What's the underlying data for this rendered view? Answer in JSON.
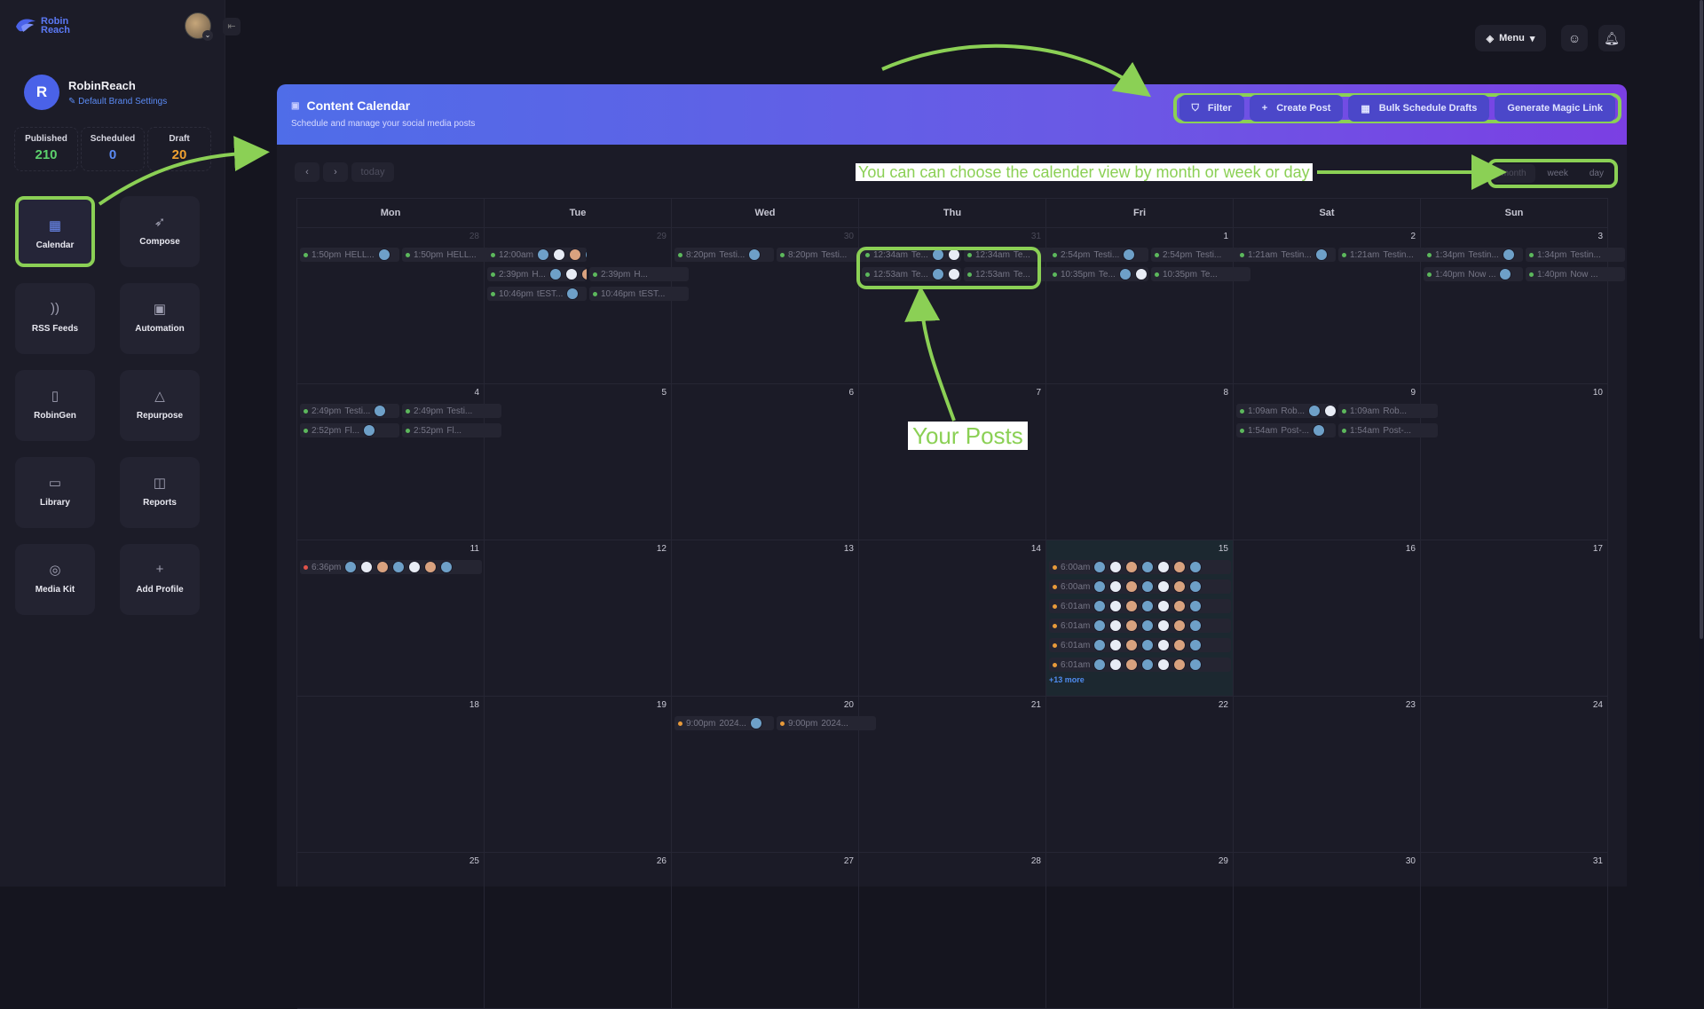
{
  "logo": {
    "text": "Robin Reach"
  },
  "profile": {
    "initial": "R",
    "name": "RobinReach",
    "brand_settings": "Default Brand Settings"
  },
  "stats": [
    {
      "label": "Published",
      "value": "210",
      "color": "#5cd06c"
    },
    {
      "label": "Scheduled",
      "value": "0",
      "color": "#5b8bf5"
    },
    {
      "label": "Draft",
      "value": "20",
      "color": "#f0a030"
    }
  ],
  "tiles": [
    {
      "label": "Calendar",
      "icon": "calendar-icon",
      "glyph": "▦"
    },
    {
      "label": "Compose",
      "icon": "rocket-icon",
      "glyph": "➶"
    },
    {
      "label": "RSS Feeds",
      "icon": "rss-icon",
      "glyph": "))"
    },
    {
      "label": "Automation",
      "icon": "robot-icon",
      "glyph": "▣"
    },
    {
      "label": "RobinGen",
      "icon": "document-icon",
      "glyph": "▯"
    },
    {
      "label": "Repurpose",
      "icon": "recycle-icon",
      "glyph": "△"
    },
    {
      "label": "Library",
      "icon": "folder-icon",
      "glyph": "▭"
    },
    {
      "label": "Reports",
      "icon": "chart-icon",
      "glyph": "◫"
    },
    {
      "label": "Media Kit",
      "icon": "grid-icon",
      "glyph": "◎"
    },
    {
      "label": "Add Profile",
      "icon": "plus-icon",
      "glyph": "+"
    }
  ],
  "topbar": {
    "menu_label": "Menu"
  },
  "header": {
    "title": "Content Calendar",
    "subtitle": "Schedule and manage your social media posts",
    "buttons": [
      {
        "label": "Filter",
        "icon": "filter-icon",
        "glyph": "⛉"
      },
      {
        "label": "Create Post",
        "icon": "plus-icon",
        "glyph": "+"
      },
      {
        "label": "Bulk Schedule Drafts",
        "icon": "calendar-icon",
        "glyph": "▦"
      },
      {
        "label": "Generate Magic Link",
        "icon": "",
        "glyph": ""
      }
    ]
  },
  "nav": {
    "prev": "‹",
    "next": "›",
    "today": "today"
  },
  "views": [
    "month",
    "week",
    "day"
  ],
  "weekdays": [
    "Mon",
    "Tue",
    "Wed",
    "Thu",
    "Fri",
    "Sat",
    "Sun"
  ],
  "days": [
    "28",
    "29",
    "30",
    "31",
    "1",
    "2",
    "3",
    "4",
    "5",
    "6",
    "7",
    "8",
    "9",
    "10",
    "11",
    "12",
    "13",
    "14",
    "15",
    "16",
    "17",
    "18",
    "19",
    "20",
    "21",
    "22",
    "23",
    "24",
    "25",
    "26",
    "27",
    "28",
    "29",
    "30",
    "31"
  ],
  "events": [
    {
      "cell": 0,
      "row": 0,
      "half": 0,
      "time": "1:50pm",
      "text": "HELL...",
      "avatars": 1
    },
    {
      "cell": 0,
      "row": 0,
      "half": 1,
      "time": "1:50pm",
      "text": "HELL...",
      "avatars": 0
    },
    {
      "cell": 1,
      "row": 0,
      "half": 0,
      "time": "12:00am",
      "text": "",
      "avatars": 6
    },
    {
      "cell": 1,
      "row": 1,
      "half": 0,
      "time": "2:39pm",
      "text": "H...",
      "avatars": 3
    },
    {
      "cell": 1,
      "row": 1,
      "half": 1,
      "time": "2:39pm",
      "text": "H...",
      "avatars": 0
    },
    {
      "cell": 1,
      "row": 2,
      "half": 0,
      "time": "10:46pm",
      "text": "tEST...",
      "avatars": 1
    },
    {
      "cell": 1,
      "row": 2,
      "half": 1,
      "time": "10:46pm",
      "text": "tEST...",
      "avatars": 0
    },
    {
      "cell": 2,
      "row": 0,
      "half": 0,
      "time": "8:20pm",
      "text": "Testi...",
      "avatars": 1
    },
    {
      "cell": 2,
      "row": 0,
      "half": 1,
      "time": "8:20pm",
      "text": "Testi...",
      "avatars": 0
    },
    {
      "cell": 3,
      "row": 0,
      "half": 0,
      "time": "12:34am",
      "text": "Te...",
      "avatars": 2
    },
    {
      "cell": 3,
      "row": 0,
      "half": 1,
      "time": "12:34am",
      "text": "Te...",
      "avatars": 0
    },
    {
      "cell": 3,
      "row": 1,
      "half": 0,
      "time": "12:53am",
      "text": "Te...",
      "avatars": 2
    },
    {
      "cell": 3,
      "row": 1,
      "half": 1,
      "time": "12:53am",
      "text": "Te...",
      "avatars": 0
    },
    {
      "cell": 4,
      "row": 0,
      "half": 0,
      "time": "2:54pm",
      "text": "Testi...",
      "avatars": 1
    },
    {
      "cell": 4,
      "row": 0,
      "half": 1,
      "time": "2:54pm",
      "text": "Testi...",
      "avatars": 0
    },
    {
      "cell": 4,
      "row": 1,
      "half": 0,
      "time": "10:35pm",
      "text": "Te...",
      "avatars": 2
    },
    {
      "cell": 4,
      "row": 1,
      "half": 1,
      "time": "10:35pm",
      "text": "Te...",
      "avatars": 0
    },
    {
      "cell": 5,
      "row": 0,
      "half": 0,
      "time": "1:21am",
      "text": "Testin...",
      "avatars": 1
    },
    {
      "cell": 5,
      "row": 0,
      "half": 1,
      "time": "1:21am",
      "text": "Testin...",
      "avatars": 0
    },
    {
      "cell": 6,
      "row": 0,
      "half": 0,
      "time": "1:34pm",
      "text": "Testin...",
      "avatars": 1
    },
    {
      "cell": 6,
      "row": 0,
      "half": 1,
      "time": "1:34pm",
      "text": "Testin...",
      "avatars": 0
    },
    {
      "cell": 6,
      "row": 1,
      "half": 0,
      "time": "1:40pm",
      "text": "Now ...",
      "avatars": 1
    },
    {
      "cell": 6,
      "row": 1,
      "half": 1,
      "time": "1:40pm",
      "text": "Now ...",
      "avatars": 0
    },
    {
      "cell": 7,
      "row": 0,
      "half": 0,
      "time": "2:49pm",
      "text": "Testi...",
      "avatars": 1
    },
    {
      "cell": 7,
      "row": 0,
      "half": 1,
      "time": "2:49pm",
      "text": "Testi...",
      "avatars": 0
    },
    {
      "cell": 7,
      "row": 1,
      "half": 0,
      "time": "2:52pm",
      "text": "Fl...",
      "avatars": 1
    },
    {
      "cell": 7,
      "row": 1,
      "half": 1,
      "time": "2:52pm",
      "text": "Fl...",
      "avatars": 0
    },
    {
      "cell": 12,
      "row": 0,
      "half": 0,
      "time": "1:09am",
      "text": "Rob...",
      "avatars": 2
    },
    {
      "cell": 12,
      "row": 0,
      "half": 1,
      "time": "1:09am",
      "text": "Rob...",
      "avatars": 0
    },
    {
      "cell": 12,
      "row": 1,
      "half": 0,
      "time": "1:54am",
      "text": "Post-...",
      "avatars": 1
    },
    {
      "cell": 12,
      "row": 1,
      "half": 1,
      "time": "1:54am",
      "text": "Post-...",
      "avatars": 0
    },
    {
      "cell": 14,
      "row": 0,
      "half": 2,
      "time": "6:36pm",
      "text": "",
      "avatars": 7,
      "dot": "r"
    },
    {
      "cell": 18,
      "row": 0,
      "half": 2,
      "time": "6:00am",
      "text": "",
      "avatars": 7,
      "dot": "o"
    },
    {
      "cell": 18,
      "row": 1,
      "half": 2,
      "time": "6:00am",
      "text": "",
      "avatars": 7,
      "dot": "o"
    },
    {
      "cell": 18,
      "row": 2,
      "half": 2,
      "time": "6:01am",
      "text": "",
      "avatars": 7,
      "dot": "o"
    },
    {
      "cell": 18,
      "row": 3,
      "half": 2,
      "time": "6:01am",
      "text": "",
      "avatars": 7,
      "dot": "o"
    },
    {
      "cell": 18,
      "row": 4,
      "half": 2,
      "time": "6:01am",
      "text": "",
      "avatars": 7,
      "dot": "o"
    },
    {
      "cell": 18,
      "row": 5,
      "half": 2,
      "time": "6:01am",
      "text": "",
      "avatars": 7,
      "dot": "o"
    },
    {
      "cell": 23,
      "row": 0,
      "half": 0,
      "time": "9:00pm",
      "text": "2024...",
      "avatars": 1,
      "dot": "o"
    },
    {
      "cell": 23,
      "row": 0,
      "half": 1,
      "time": "9:00pm",
      "text": "2024...",
      "avatars": 0,
      "dot": "o"
    }
  ],
  "more_link": "+13 more",
  "annotations": {
    "view_note": "You can can choose the calender view by month or week or day",
    "posts_note": "Your Posts"
  },
  "colors": {
    "accent_green": "#8bd055",
    "brand_blue": "#4f6de8"
  }
}
